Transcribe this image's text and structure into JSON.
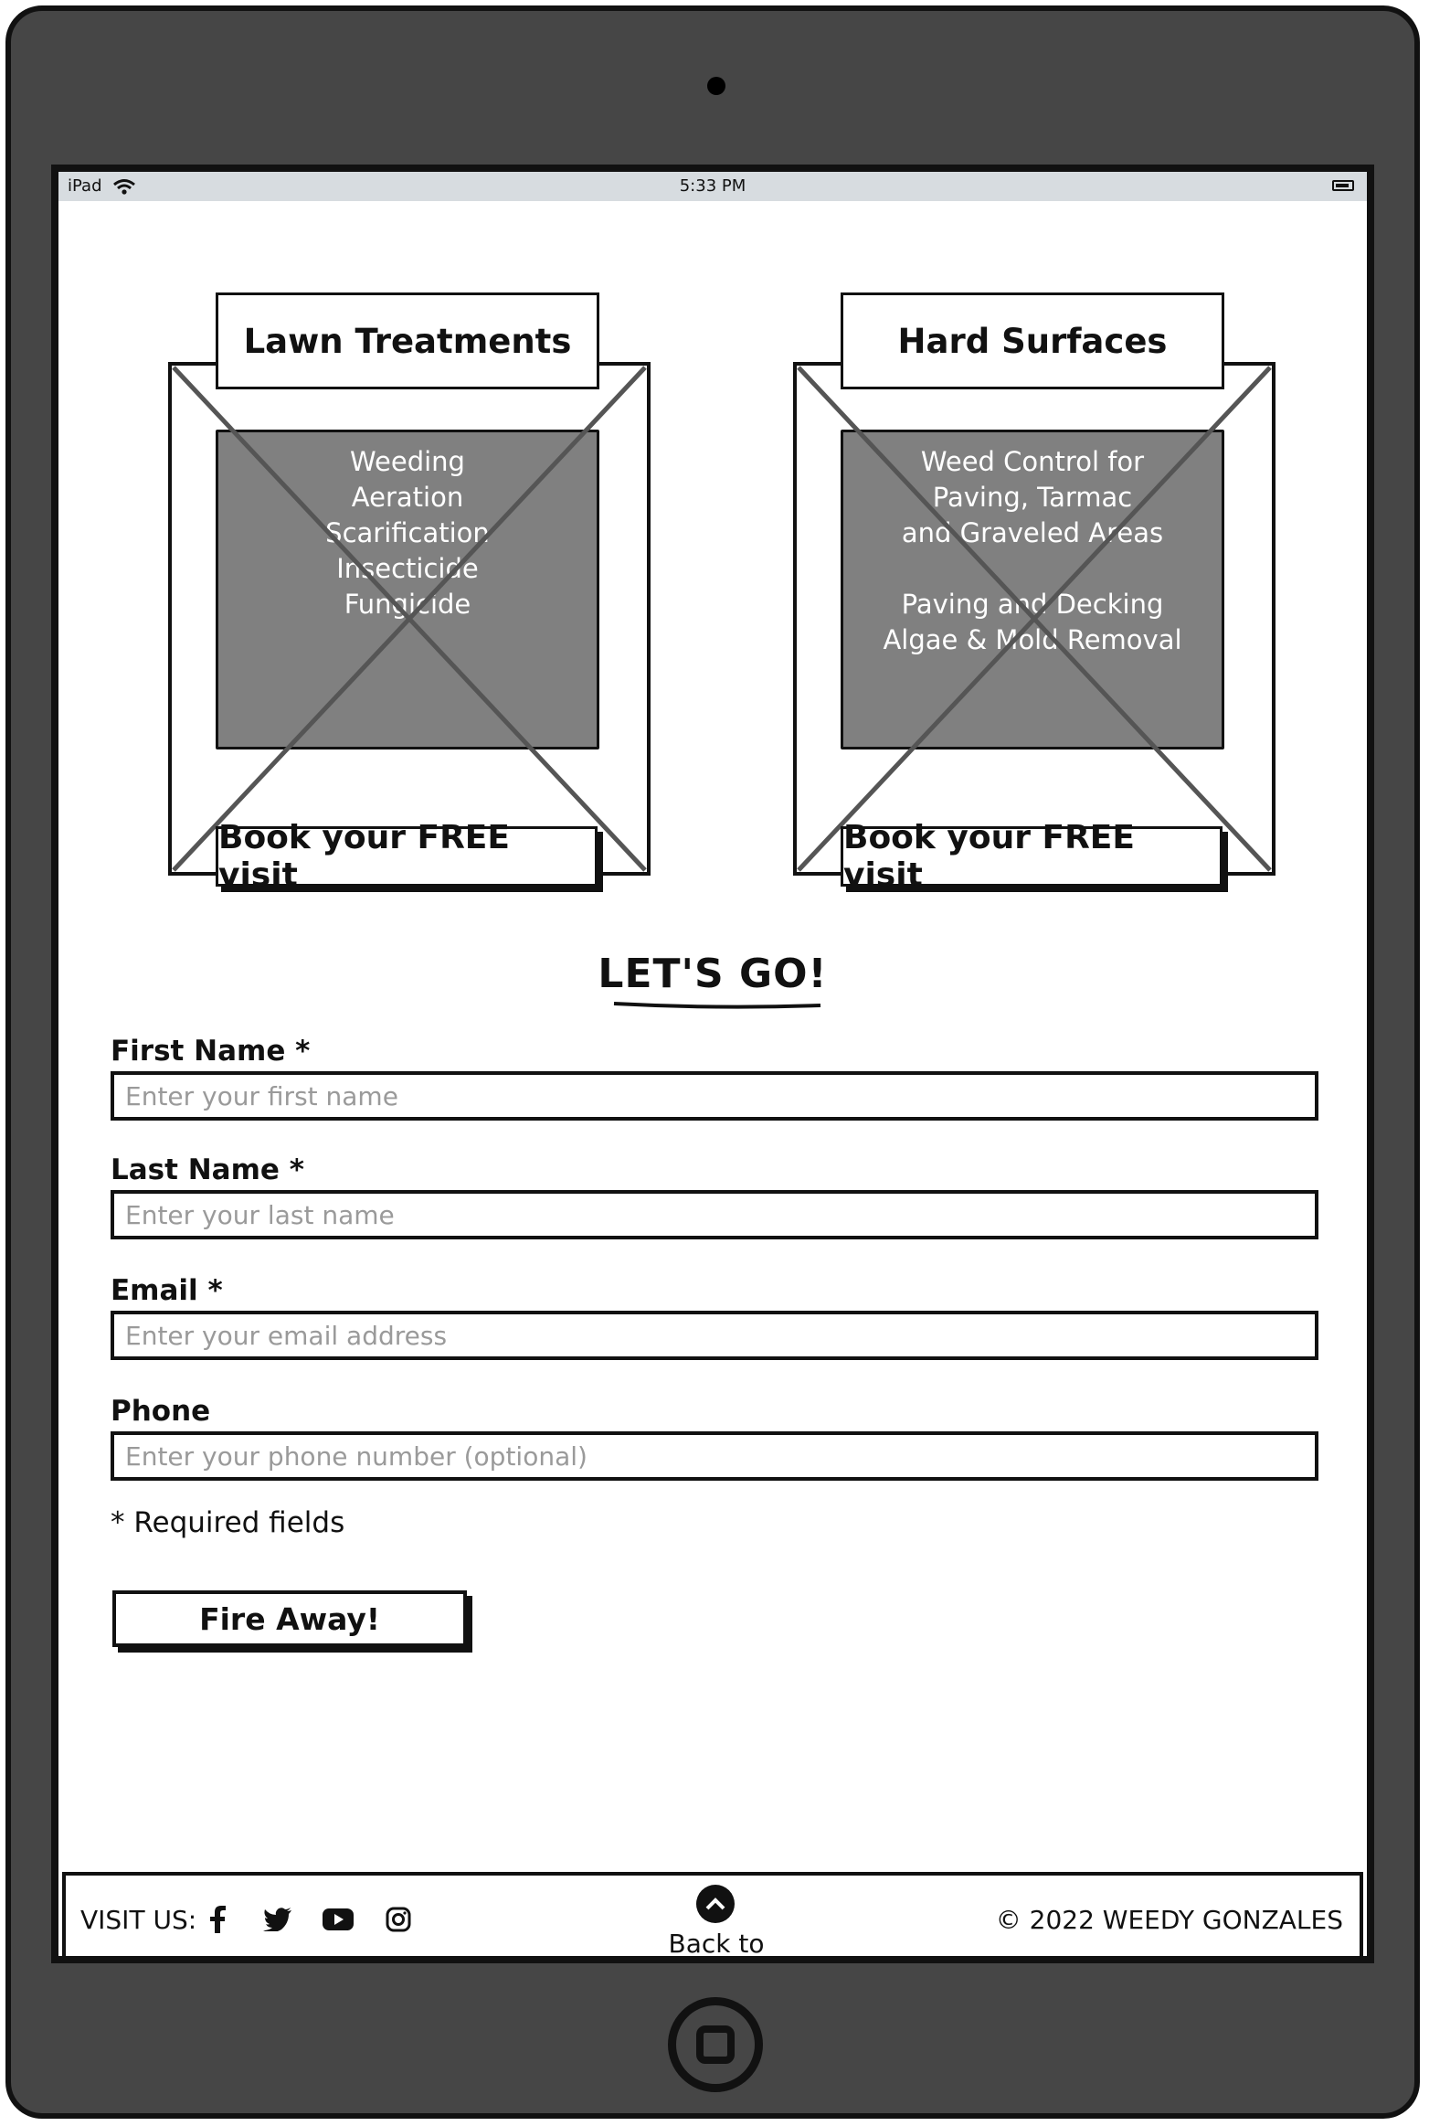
{
  "status_bar": {
    "device": "iPad",
    "time": "5:33 PM"
  },
  "cards": [
    {
      "title": "Lawn Treatments",
      "services": [
        "Weeding",
        "Aeration",
        "Scarification",
        "Insecticide",
        "Fungicide"
      ],
      "button": "Book your FREE visit"
    },
    {
      "title": "Hard Surfaces",
      "services": [
        "Weed Control for",
        "Paving, Tarmac",
        "and Graveled Areas",
        "",
        "Paving and Decking",
        "Algae & Mold Removal"
      ],
      "button": "Book your FREE visit"
    }
  ],
  "form": {
    "heading": "LET'S GO!",
    "fields": [
      {
        "label": "First Name *",
        "placeholder": "Enter your first name"
      },
      {
        "label": "Last Name *",
        "placeholder": "Enter your last name"
      },
      {
        "label": "Email *",
        "placeholder": "Enter your email address"
      },
      {
        "label": "Phone",
        "placeholder": "Enter your phone number (optional)"
      }
    ],
    "required_note": "* Required fields",
    "submit": "Fire Away!"
  },
  "footer": {
    "visit_label": "VISIT US:",
    "social_icons": [
      "facebook-icon",
      "twitter-icon",
      "youtube-icon",
      "instagram-icon"
    ],
    "back_to_top": "Back to top",
    "copyright": "© 2022 WEEDY GONZALES"
  }
}
